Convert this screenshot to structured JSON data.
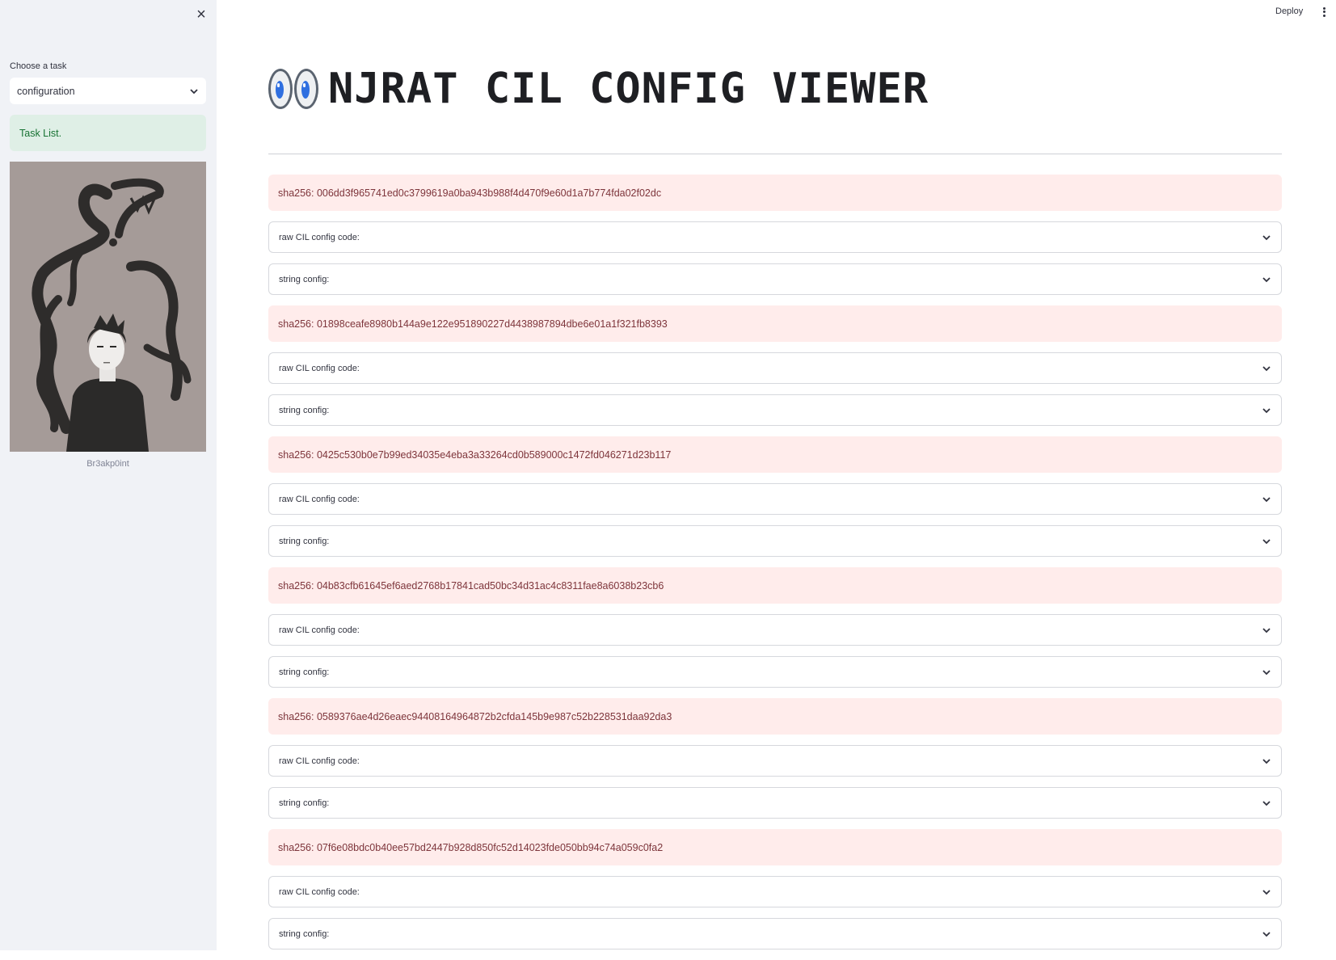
{
  "sidebar": {
    "close_glyph": "×",
    "select_label": "Choose a task",
    "select_value": "configuration",
    "info_text": "Task List.",
    "avatar_caption": "Br3akp0int"
  },
  "topbar": {
    "deploy_label": "Deploy"
  },
  "main": {
    "title": "NJRAT CIL CONFIG VIEWER",
    "title_icon": "eyes-emoji",
    "expander_raw_label": "raw CIL config code:",
    "expander_string_label": "string config:",
    "samples": [
      {
        "sha": "sha256: 006dd3f965741ed0c3799619a0ba943b988f4d470f9e60d1a7b774fda02f02dc"
      },
      {
        "sha": "sha256: 01898ceafe8980b144a9e122e951890227d4438987894dbe6e01a1f321fb8393"
      },
      {
        "sha": "sha256: 0425c530b0e7b99ed34035e4eba3a33264cd0b589000c1472fd046271d23b117"
      },
      {
        "sha": "sha256: 04b83cfb61645ef6aed2768b17841cad50bc34d31ac4c8311fae8a6038b23cb6"
      },
      {
        "sha": "sha256: 0589376ae4d26eaec94408164964872b2cfda145b9e987c52b228531daa92da3"
      },
      {
        "sha": "sha256: 07f6e08bdc0b40ee57bd2447b928d850fc52d14023fde050bb94c74a059c0fa2"
      }
    ]
  },
  "colors": {
    "sidebar_bg": "#f0f2f6",
    "error_bg": "#ffeceb",
    "error_text": "#7d353b",
    "success_bg": "#dfefe6",
    "success_text": "#177233"
  }
}
